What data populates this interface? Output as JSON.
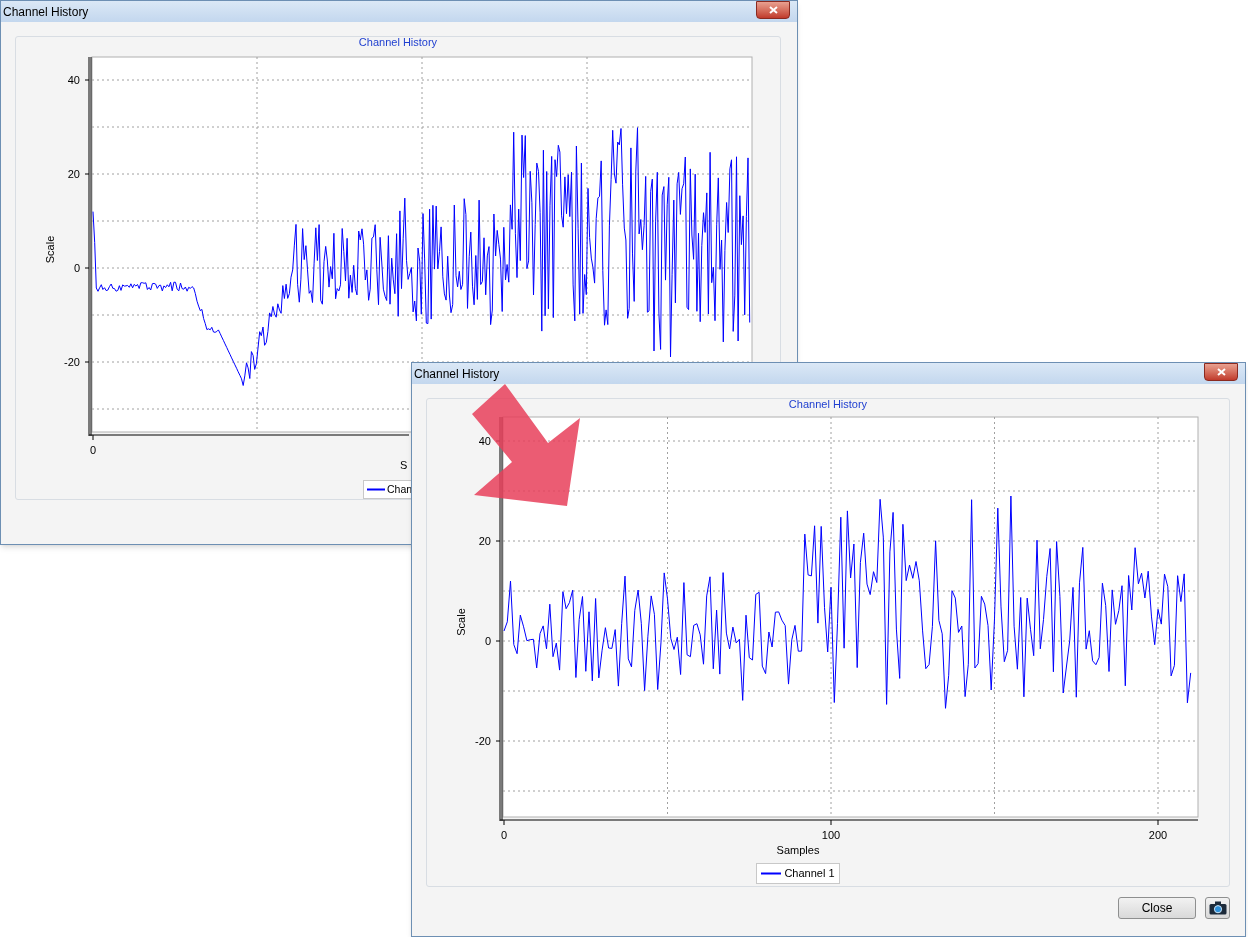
{
  "windows": [
    {
      "title": "Channel History",
      "chart": {
        "title": "Channel History",
        "ylabel": "Scale",
        "yticks": [
          "40",
          "20",
          "0",
          "-20"
        ],
        "xticks": [
          "0"
        ],
        "xlabel": "S",
        "legend": "Chan"
      }
    },
    {
      "title": "Channel History",
      "chart": {
        "title": "Channel History",
        "ylabel": "Scale",
        "yticks": [
          "40",
          "20",
          "0",
          "-20"
        ],
        "xticks": [
          "0",
          "100",
          "200"
        ],
        "xlabel": "Samples",
        "legend": "Channel 1"
      },
      "buttons": [
        "Close"
      ]
    }
  ]
}
